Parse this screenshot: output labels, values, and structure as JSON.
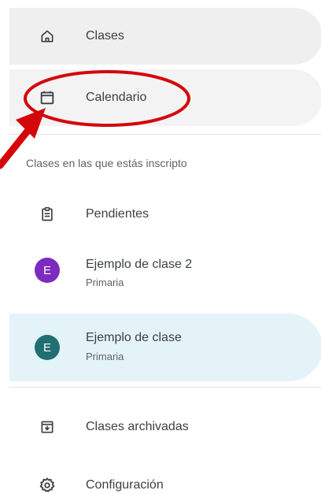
{
  "nav": {
    "top_items": [
      {
        "label": "Clases",
        "icon": "home-icon"
      },
      {
        "label": "Calendario",
        "icon": "calendar-icon"
      }
    ],
    "section_title": "Clases en las que estás inscripto",
    "enrolled": [
      {
        "label": "Pendientes",
        "icon": "assignment-icon"
      },
      {
        "label": "Ejemplo de clase 2",
        "sub": "Primaria",
        "avatar_letter": "E",
        "avatar_color": "#7b2cbf"
      },
      {
        "label": "Ejemplo de clase",
        "sub": "Primaria",
        "avatar_letter": "E",
        "avatar_color": "#1f6f73",
        "selected": true
      }
    ],
    "bottom_items": [
      {
        "label": "Clases archivadas",
        "icon": "archive-icon"
      },
      {
        "label": "Configuración",
        "icon": "gear-icon"
      }
    ]
  },
  "colors": {
    "annotation": "#d4070b",
    "selected_bg": "#e4f3f8"
  }
}
